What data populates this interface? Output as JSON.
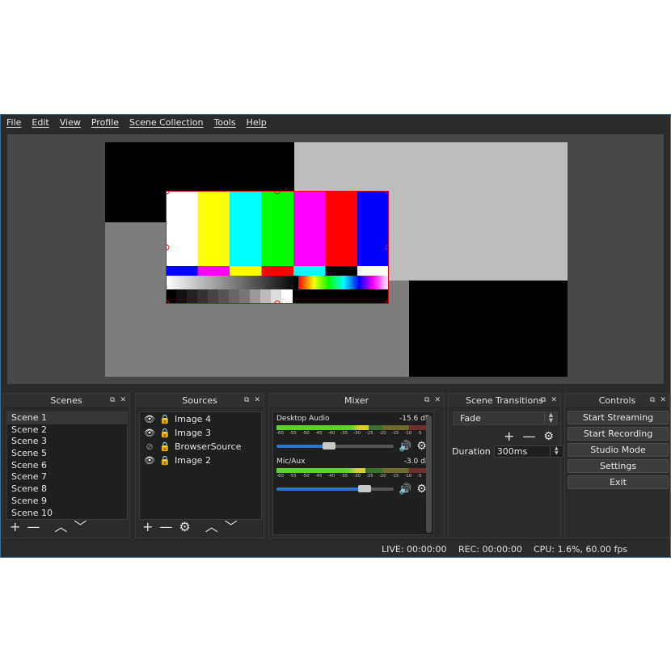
{
  "menu": [
    "File",
    "Edit",
    "View",
    "Profile",
    "Scene Collection",
    "Tools",
    "Help"
  ],
  "docks": {
    "scenes": {
      "title": "Scenes",
      "items": [
        "Scene 1",
        "Scene 2",
        "Scene 3",
        "Scene 5",
        "Scene 6",
        "Scene 7",
        "Scene 8",
        "Scene 9",
        "Scene 10"
      ],
      "selected_index": 0
    },
    "sources": {
      "title": "Sources",
      "items": [
        {
          "name": "Image 4",
          "visible": true,
          "locked": true
        },
        {
          "name": "Image 3",
          "visible": true,
          "locked": true
        },
        {
          "name": "BrowserSource",
          "visible": false,
          "locked": true
        },
        {
          "name": "Image 2",
          "visible": true,
          "locked": true
        }
      ]
    },
    "mixer": {
      "title": "Mixer",
      "channels": [
        {
          "name": "Desktop Audio",
          "db": "-15.6 dB",
          "level": 0.6,
          "volume": 0.45
        },
        {
          "name": "Mic/Aux",
          "db": "-3.0 dB",
          "level": 0.58,
          "volume": 0.75
        }
      ],
      "scale": [
        "-60",
        "-55",
        "-50",
        "-45",
        "-40",
        "-35",
        "-30",
        "-25",
        "-20",
        "-15",
        "-10",
        "-5",
        "0"
      ]
    },
    "transitions": {
      "title": "Scene Transitions",
      "selected": "Fade",
      "duration_label": "Duration",
      "duration_value": "300ms"
    },
    "controls": {
      "title": "Controls",
      "buttons": [
        "Start Streaming",
        "Start Recording",
        "Studio Mode",
        "Settings",
        "Exit"
      ]
    }
  },
  "status": {
    "live": "LIVE: 00:00:00",
    "rec": "REC: 00:00:00",
    "cpu": "CPU: 1.6%, 60.00 fps"
  },
  "colors": {
    "accent": "#2f76c9",
    "selection_border": "#d01010",
    "window_bg": "#2b2b2b"
  }
}
